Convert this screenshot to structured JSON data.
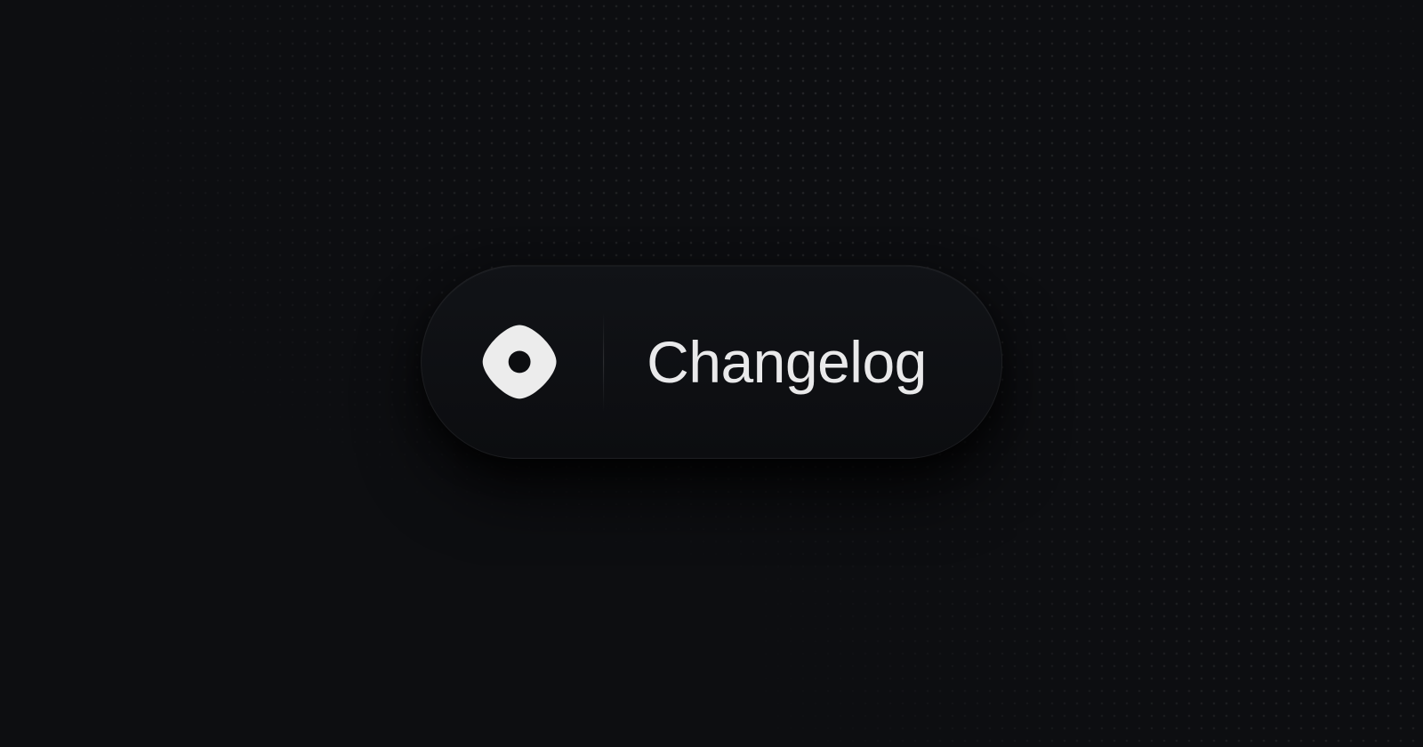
{
  "card": {
    "title": "Changelog"
  }
}
